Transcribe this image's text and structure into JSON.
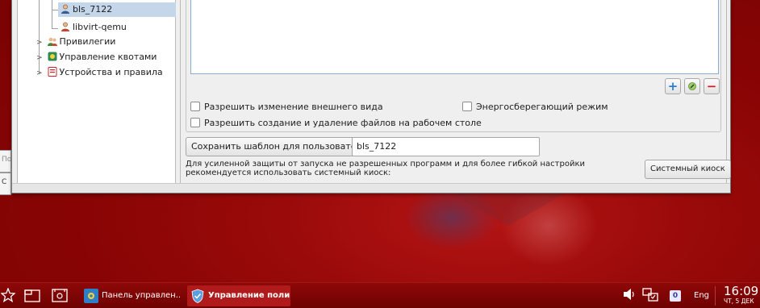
{
  "background_windows": {
    "fragment1": "По",
    "fragment2": "С"
  },
  "tree": {
    "items": [
      {
        "label": "bls_7122",
        "selected": true
      },
      {
        "label": "libvirt-qemu",
        "selected": false
      },
      {
        "label": "Привилегии",
        "selected": false
      },
      {
        "label": "Управление квотами",
        "selected": false
      },
      {
        "label": "Устройства и правила",
        "selected": false
      }
    ]
  },
  "list_buttons": {
    "add": "+",
    "remove": "−"
  },
  "options": {
    "allow_appearance_change": "Разрешить изменение внешнего вида",
    "power_saving": "Энергосберегающий режим",
    "allow_desktop_files": "Разрешить создание и удаление файлов на рабочем столе"
  },
  "template": {
    "save_label": "Сохранить шаблон для пользователя:",
    "user_value": "bls_7122"
  },
  "kiosk": {
    "hint": "Для усиленной защиты от запуска не разрешенных программ и для более гибкой настройки рекомендуется использовать системный киоск:",
    "button": "Системный киоск"
  },
  "taskbar": {
    "tasks": [
      {
        "label": "Панель управлен...",
        "active": false
      },
      {
        "label": "Управление поли...",
        "active": true
      }
    ],
    "language": "Eng",
    "workspace": "0",
    "time": "16:09",
    "date": "ЧТ, 5 ДЕК"
  },
  "colors": {
    "selection": "#c3d6ea",
    "taskbar": "#7e0404",
    "remove_red": "#d2202a",
    "add_blue": "#2a7fd4"
  }
}
